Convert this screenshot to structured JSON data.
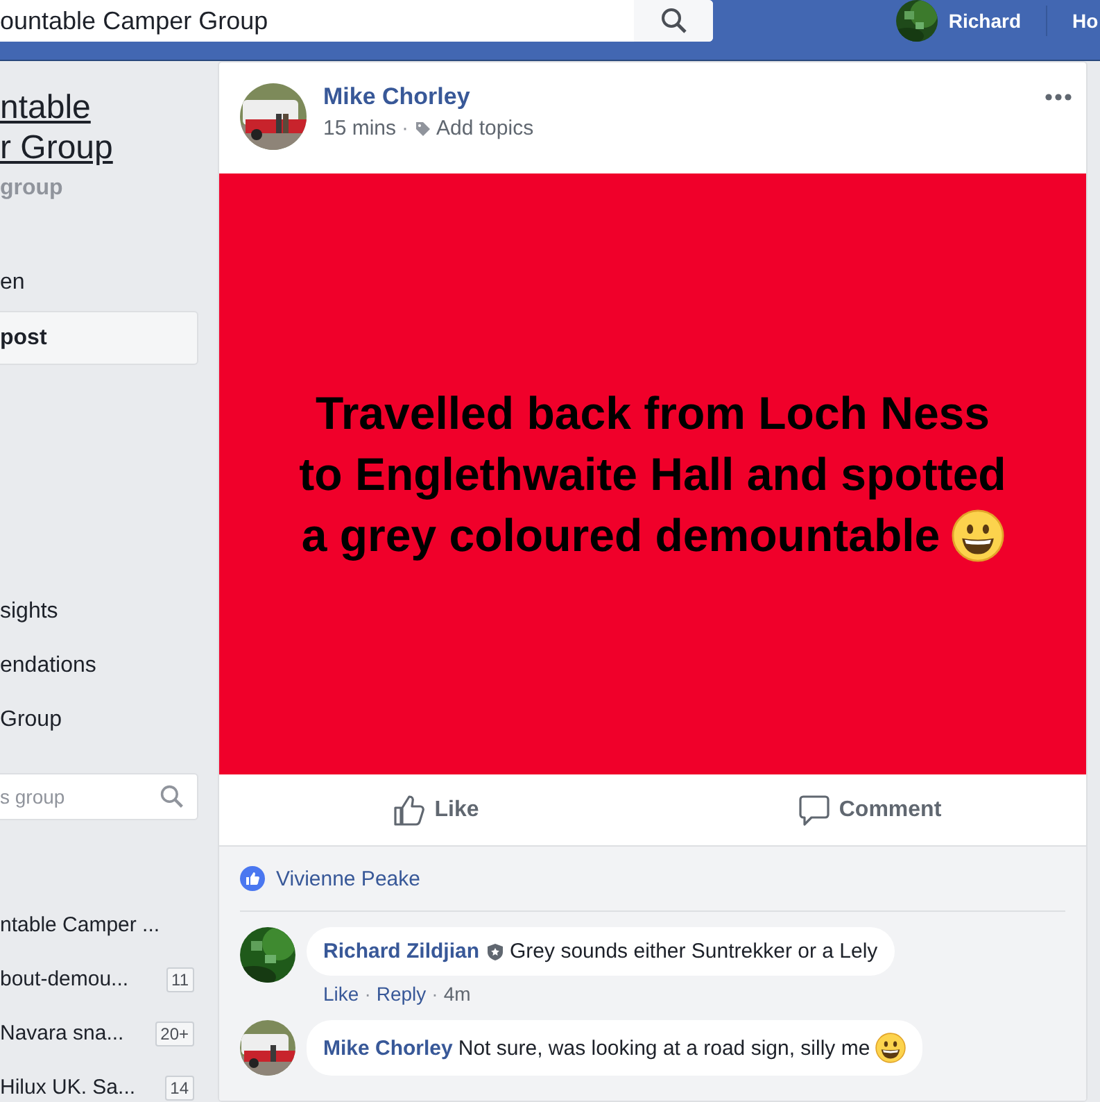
{
  "top_bar": {
    "search": {
      "value": "ountable Camper Group"
    },
    "user": {
      "name": "Richard"
    },
    "nav_link": "Ho"
  },
  "sidebar": {
    "group_title": [
      "ntable",
      "r Group"
    ],
    "group_type": "group",
    "nav_items": [
      {
        "label": "en",
        "selected": false
      },
      {
        "label": "post",
        "selected": true
      },
      {
        "label": "sights",
        "selected": false
      },
      {
        "label": "endations",
        "selected": false
      },
      {
        "label": "Group",
        "selected": false
      }
    ],
    "search": {
      "placeholder": "s group"
    },
    "shortcuts": [
      {
        "label": "ntable Camper ..."
      },
      {
        "label": "bout-demou...",
        "count": "11"
      },
      {
        "label": "Navara sna...",
        "count": "20+"
      },
      {
        "label": "Hilux UK. Sa...",
        "count": "14"
      }
    ]
  },
  "post": {
    "author": "Mike Chorley",
    "time": "15 mins",
    "separator": "·",
    "topics": "Add topics",
    "text": "Travelled back from Loch Ness to Englethwaite Hall and spotted a grey coloured demountable",
    "emoji_end": true,
    "actions": [
      {
        "kind": "like",
        "label": "Like"
      },
      {
        "kind": "comment",
        "label": "Comment"
      }
    ],
    "likers": "Vivienne Peake",
    "comments": [
      {
        "author": "Richard Zildjian",
        "admin": true,
        "text": "Grey sounds either Suntrekker or a Lely",
        "emoji_end": false,
        "meta": [
          "Like",
          "·",
          "Reply",
          "·",
          "4m"
        ]
      },
      {
        "author": "Mike Chorley",
        "admin": false,
        "text": "Not sure, was looking at a road sign, silly me",
        "emoji_end": true
      }
    ]
  }
}
